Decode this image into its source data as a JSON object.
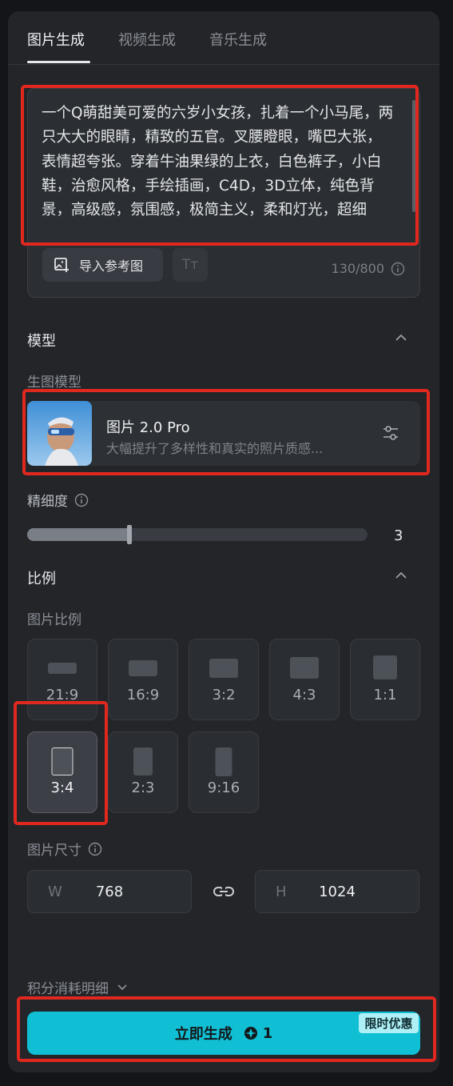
{
  "tabs": [
    {
      "label": "图片生成",
      "active": true
    },
    {
      "label": "视频生成",
      "active": false
    },
    {
      "label": "音乐生成",
      "active": false
    }
  ],
  "prompt": {
    "text": "一个Q萌甜美可爱的六岁小女孩，扎着一个小马尾，两只大大的眼睛，精致的五官。叉腰瞪眼，嘴巴大张，表情超夸张。穿着牛油果绿的上衣，白色裤子，小白鞋，治愈风格，手绘插画，C4D，3D立体，纯色背景，高级感，氛围感，极简主义，柔和灯光，超细节，超细腻，超高清，优秀作品",
    "char_count": "130/800",
    "import_ref_label": "导入参考图",
    "text_style_icon": "Tт"
  },
  "model_section": {
    "title": "模型",
    "label": "生图模型",
    "model_name": "图片 2.0 Pro",
    "model_desc": "大幅提升了多样性和真实的照片质感..."
  },
  "detail": {
    "label": "精细度",
    "value": "3",
    "fill_fraction": 0.3
  },
  "ratio_section": {
    "title": "比例",
    "label": "图片比例",
    "options": [
      {
        "label": "21:9",
        "selected": false
      },
      {
        "label": "16:9",
        "selected": false
      },
      {
        "label": "3:2",
        "selected": false
      },
      {
        "label": "4:3",
        "selected": false
      },
      {
        "label": "1:1",
        "selected": false
      },
      {
        "label": "3:4",
        "selected": true
      },
      {
        "label": "2:3",
        "selected": false
      },
      {
        "label": "9:16",
        "selected": false
      }
    ]
  },
  "size": {
    "label": "图片尺寸",
    "width_axis": "W",
    "width_value": "768",
    "height_axis": "H",
    "height_value": "1024"
  },
  "cost_detail_label": "积分消耗明细",
  "generate": {
    "label": "立即生成",
    "credits": "1",
    "promo_badge": "限时优惠"
  },
  "colors": {
    "accent": "#10bfd3",
    "highlight_border": "#e0281e"
  }
}
